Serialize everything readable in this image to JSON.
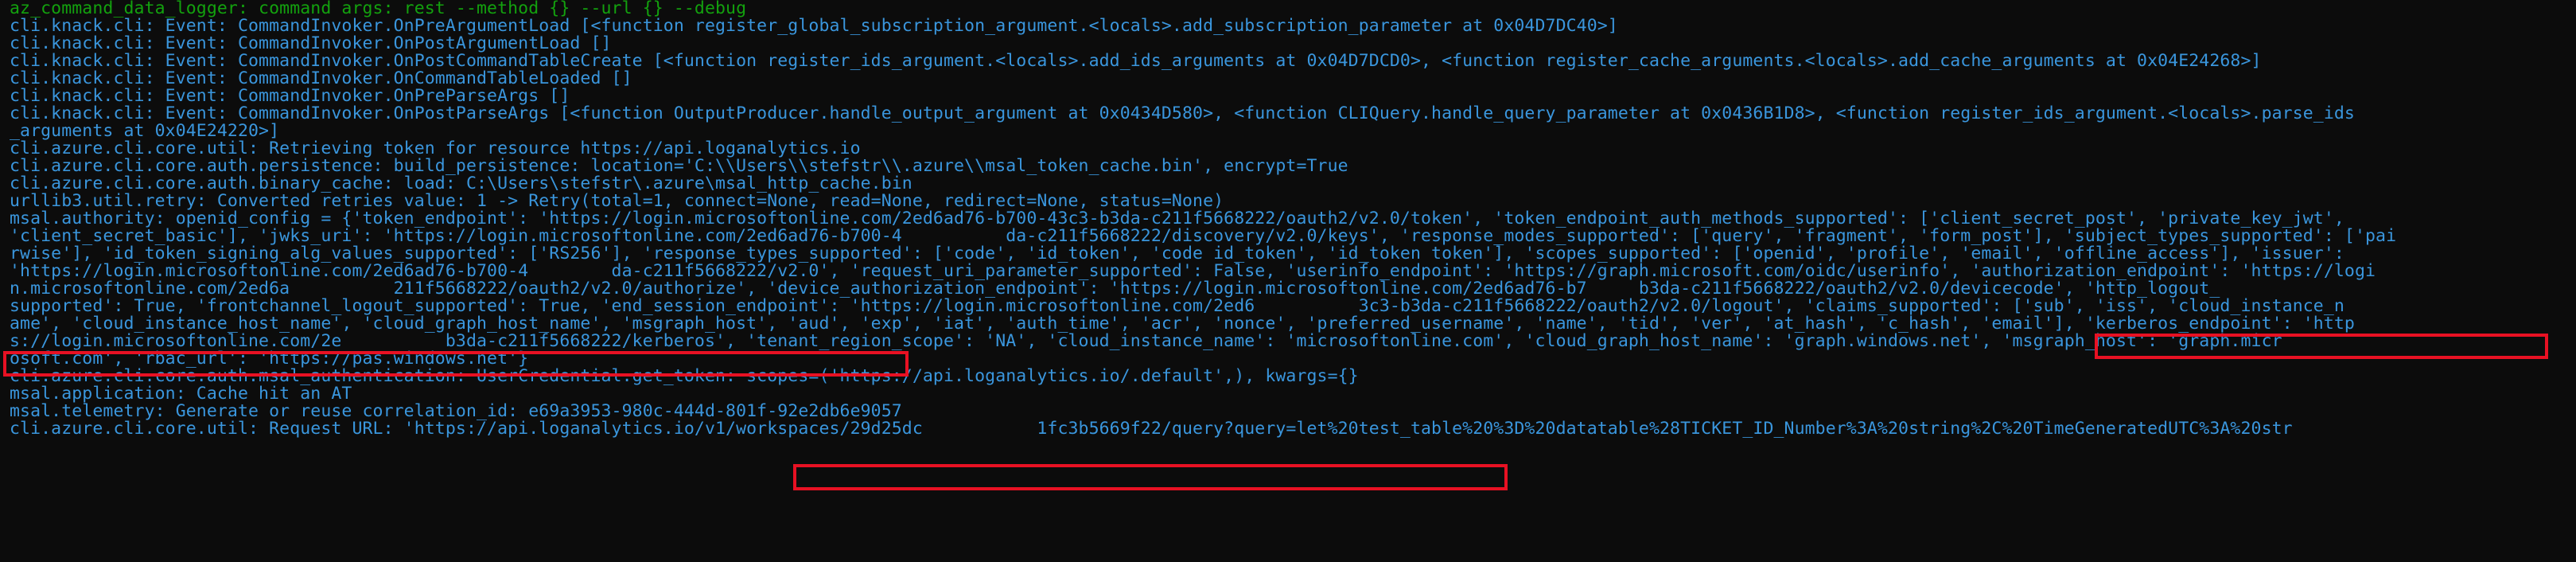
{
  "window": {
    "background": "#0c0c0c",
    "text_color": "#3a96dd",
    "green_color": "#13a10e",
    "highlight_color": "#e81123"
  },
  "lines": [
    {
      "text": "az_command_data_logger: command args: rest --method {} --url {} --debug",
      "style": "green"
    },
    {
      "text": "cli.knack.cli: Event: CommandInvoker.OnPreArgumentLoad [<function register_global_subscription_argument.<locals>.add_subscription_parameter at 0x04D7DC40>]"
    },
    {
      "text": "cli.knack.cli: Event: CommandInvoker.OnPostArgumentLoad []"
    },
    {
      "text": "cli.knack.cli: Event: CommandInvoker.OnPostCommandTableCreate [<function register_ids_argument.<locals>.add_ids_arguments at 0x04D7DCD0>, <function register_cache_arguments.<locals>.add_cache_arguments at 0x04E24268>]"
    },
    {
      "text": "cli.knack.cli: Event: CommandInvoker.OnCommandTableLoaded []"
    },
    {
      "text": "cli.knack.cli: Event: CommandInvoker.OnPreParseArgs []"
    },
    {
      "text": "cli.knack.cli: Event: CommandInvoker.OnPostParseArgs [<function OutputProducer.handle_output_argument at 0x0434D580>, <function CLIQuery.handle_query_parameter at 0x0436B1D8>, <function register_ids_argument.<locals>.parse_ids"
    },
    {
      "text": "_arguments at 0x04E24220>]"
    },
    {
      "text": "cli.azure.cli.core.util: Retrieving token for resource https://api.loganalytics.io"
    },
    {
      "text": "cli.azure.cli.core.auth.persistence: build_persistence: location='C:\\\\Users\\\\stefstr\\\\.azure\\\\msal_token_cache.bin', encrypt=True"
    },
    {
      "text": "cli.azure.cli.core.auth.binary_cache: load: C:\\Users\\stefstr\\.azure\\msal_http_cache.bin"
    },
    {
      "text": "urllib3.util.retry: Converted retries value: 1 -> Retry(total=1, connect=None, read=None, redirect=None, status=None)"
    },
    {
      "text": "msal.authority: openid_config = {'token_endpoint': 'https://login.microsoftonline.com/2ed6ad76-b700-43c3-b3da-c211f5668222/oauth2/v2.0/token', 'token_endpoint_auth_methods_supported': ['client_secret_post', 'private_key_jwt',"
    },
    {
      "text": "'client_secret_basic'], 'jwks_uri': 'https://login.microsoftonline.com/2ed6ad76-b700-4          da-c211f5668222/discovery/v2.0/keys', 'response_modes_supported': ['query', 'fragment', 'form_post'], 'subject_types_supported': ['pai"
    },
    {
      "text": "rwise'], 'id_token_signing_alg_values_supported': ['RS256'], 'response_types_supported': ['code', 'id_token', 'code id_token', 'id_token token'], 'scopes_supported': ['openid', 'profile', 'email', 'offline_access'], 'issuer':"
    },
    {
      "text": "'https://login.microsoftonline.com/2ed6ad76-b700-4        da-c211f5668222/v2.0', 'request_uri_parameter_supported': False, 'userinfo_endpoint': 'https://graph.microsoft.com/oidc/userinfo', 'authorization_endpoint': 'https://logi"
    },
    {
      "text": "n.microsoftonline.com/2ed6a          211f5668222/oauth2/v2.0/authorize', 'device_authorization_endpoint': 'https://login.microsoftonline.com/2ed6ad76-b7     b3da-c211f5668222/oauth2/v2.0/devicecode', 'http_logout_"
    },
    {
      "text": "supported': True, 'frontchannel_logout_supported': True, 'end_session_endpoint': 'https://login.microsoftonline.com/2ed6          3c3-b3da-c211f5668222/oauth2/v2.0/logout', 'claims_supported': ['sub', 'iss', 'cloud_instance_n"
    },
    {
      "text": "ame', 'cloud_instance_host_name', 'cloud_graph_host_name', 'msgraph_host', 'aud', 'exp', 'iat', 'auth_time', 'acr', 'nonce', 'preferred_username', 'name', 'tid', 'ver', 'at_hash', 'c_hash', 'email'], 'kerberos_endpoint': 'http"
    },
    {
      "text": "s://login.microsoftonline.com/2e          b3da-c211f5668222/kerberos', 'tenant_region_scope': 'NA', 'cloud_instance_name': 'microsoftonline.com', 'cloud_graph_host_name': 'graph.windows.net', 'msgraph_host': 'graph.micr"
    },
    {
      "text": "osoft.com', 'rbac_url': 'https://pas.windows.net'}"
    },
    {
      "text": "cli.azure.cli.core.auth.msal_authentication: UserCredential.get_token: scopes=('https://api.loganalytics.io/.default',), kwargs={}"
    },
    {
      "text": "msal.application: Cache hit an AT"
    },
    {
      "text": "msal.telemetry: Generate or reuse correlation_id: e69a3953-980c-444d-801f-92e2db6e9057"
    },
    {
      "text": "cli.azure.cli.core.util: Request URL: 'https://api.loganalytics.io/v1/workspaces/29d25dc           1fc3b5669f22/query?query=let%20test_table%20%3D%20datatable%28TICKET_ID_Number%3A%20string%2C%20TimeGeneratedUTC%3A%20str"
    }
  ]
}
